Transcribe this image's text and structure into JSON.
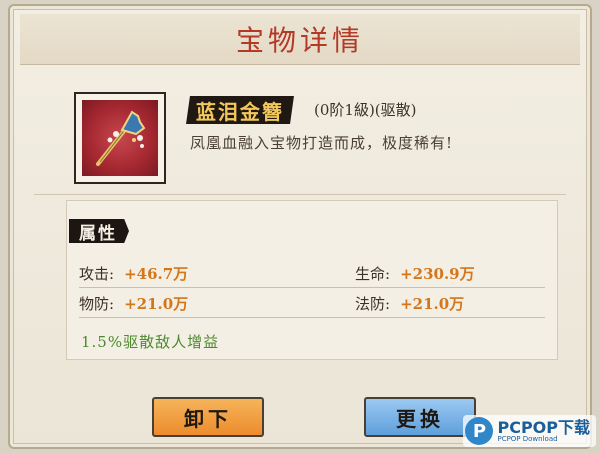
{
  "dialog": {
    "title": "宝物详情"
  },
  "item": {
    "icon": "golden-hairpin-icon",
    "name": "蓝泪金簪",
    "level_info": "(0阶1級)(驱散)",
    "description": "凤凰血融入宝物打造而成，极度稀有!"
  },
  "attributes": {
    "header": "属性",
    "stats": [
      {
        "label": "攻击:",
        "value": "+46.7万"
      },
      {
        "label": "生命:",
        "value": "+230.9万"
      },
      {
        "label": "物防:",
        "value": "+21.0万"
      },
      {
        "label": "法防:",
        "value": "+21.0万"
      }
    ],
    "buff": "1.5%驱散敌人增益"
  },
  "buttons": {
    "unequip": "卸下",
    "replace": "更换"
  },
  "watermark": {
    "logo": "P",
    "brand": "PCPOP下载",
    "sub": "PCPOP Download"
  },
  "colors": {
    "title": "#b23a26",
    "stat_value": "#d4761a",
    "buff": "#4b8a2e",
    "unequip_button": "#ec8c2d",
    "replace_button": "#5e9fdb"
  }
}
